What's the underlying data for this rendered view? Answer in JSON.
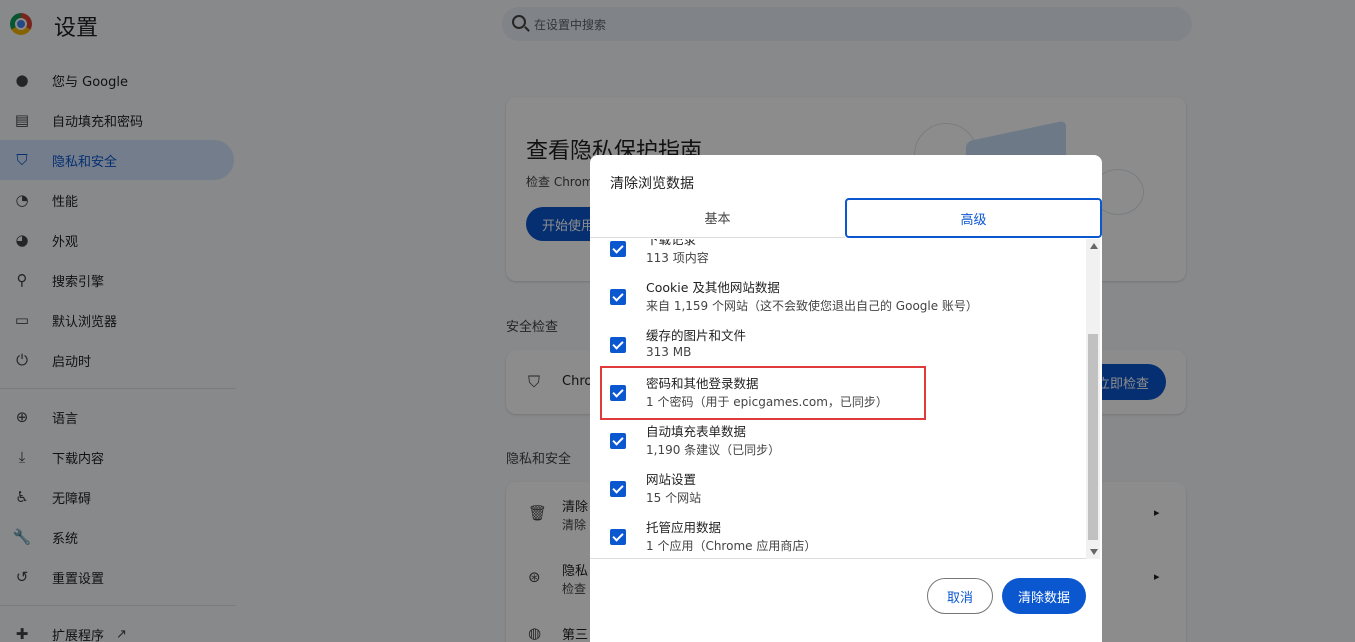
{
  "app": {
    "title": "设置"
  },
  "search": {
    "placeholder": "在设置中搜索"
  },
  "sidebar": {
    "items": [
      {
        "label": "您与 Google",
        "icon": "person-icon"
      },
      {
        "label": "自动填充和密码",
        "icon": "clipboard-icon"
      },
      {
        "label": "隐私和安全",
        "icon": "shield-icon",
        "active": true
      },
      {
        "label": "性能",
        "icon": "gauge-icon"
      },
      {
        "label": "外观",
        "icon": "palette-icon"
      },
      {
        "label": "搜索引擎",
        "icon": "search-icon"
      },
      {
        "label": "默认浏览器",
        "icon": "browser-icon"
      },
      {
        "label": "启动时",
        "icon": "power-icon"
      },
      {
        "label": "语言",
        "icon": "globe-icon"
      },
      {
        "label": "下载内容",
        "icon": "download-icon"
      },
      {
        "label": "无障碍",
        "icon": "accessibility-icon"
      },
      {
        "label": "系统",
        "icon": "wrench-icon"
      },
      {
        "label": "重置设置",
        "icon": "history-icon"
      },
      {
        "label": "扩展程序",
        "icon": "puzzle-icon"
      }
    ]
  },
  "main": {
    "guide_title": "查看隐私保护指南",
    "guide_sub": "检查 Chrom",
    "guide_button": "开始使用",
    "safety_label": "安全检查",
    "safety_text": "Chro",
    "safety_button": "立即检查",
    "privacy_label": "隐私和安全",
    "row1_title": "清除",
    "row1_sub": "清除",
    "row2_title": "隐私",
    "row2_sub": "检查",
    "row3_title": "第三"
  },
  "dialog": {
    "title": "清除浏览数据",
    "tabs": {
      "basic": "基本",
      "advanced": "高级"
    },
    "items": [
      {
        "title": "下载记录",
        "sub": "113 项内容",
        "checked": true
      },
      {
        "title": "Cookie 及其他网站数据",
        "sub": "来自 1,159 个网站（这不会致使您退出自己的 Google 账号）",
        "checked": true
      },
      {
        "title": "缓存的图片和文件",
        "sub": "313 MB",
        "checked": true
      },
      {
        "title": "密码和其他登录数据",
        "sub": "1 个密码（用于 epicgames.com，已同步）",
        "checked": true
      },
      {
        "title": "自动填充表单数据",
        "sub": "1,190 条建议（已同步）",
        "checked": true
      },
      {
        "title": "网站设置",
        "sub": "15 个网站",
        "checked": true
      },
      {
        "title": "托管应用数据",
        "sub": "1 个应用（Chrome 应用商店）",
        "checked": true
      }
    ],
    "cancel_label": "取消",
    "clear_label": "清除数据"
  },
  "colors": {
    "accent": "#0b57d0",
    "highlight": "#e03b3b"
  }
}
